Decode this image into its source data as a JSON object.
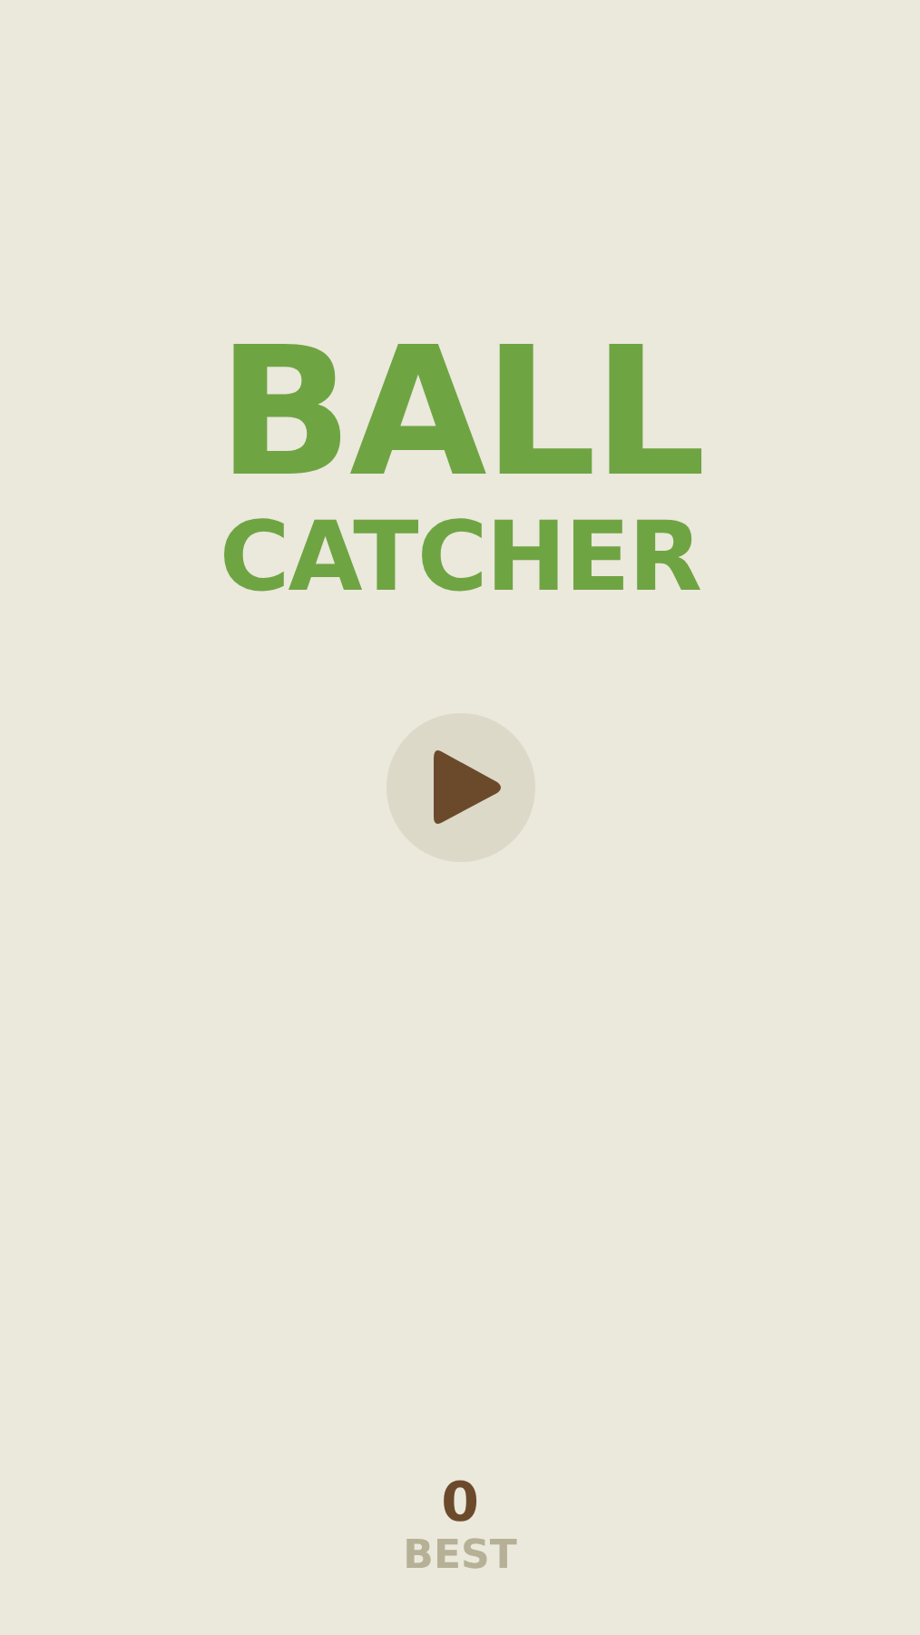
{
  "title": {
    "line_1": "BALL",
    "line_2": "CATCHER"
  },
  "play_button": {
    "kind": "play"
  },
  "best_score": {
    "value": "0",
    "label": "BEST"
  }
}
